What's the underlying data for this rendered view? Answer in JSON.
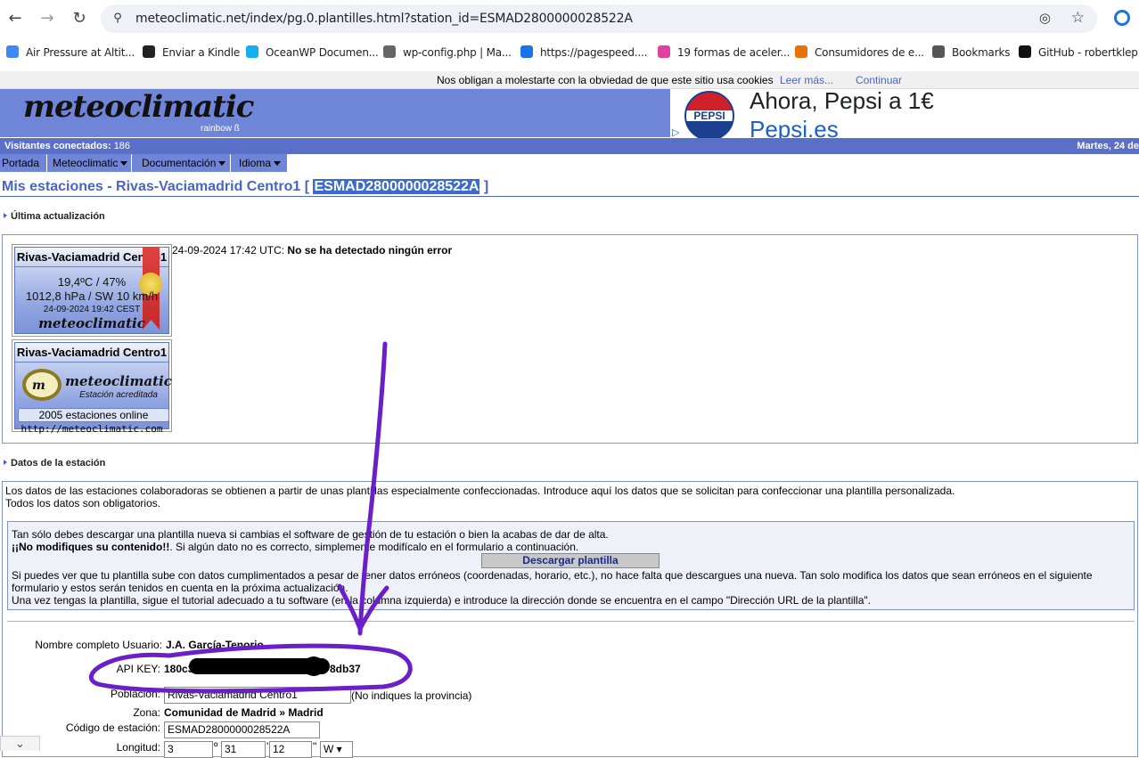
{
  "browser": {
    "url": "meteoclimatic.net/index/pg.0.plantilles.html?station_id=ESMAD2800000028522A",
    "nav_back_glyph": "←",
    "nav_forward_glyph": "→",
    "nav_reload_glyph": "↻",
    "site_info_glyph": "⚲",
    "eye_glyph": "◎",
    "star_glyph": "☆",
    "bookmarks": [
      {
        "label": "Air Pressure at Altit...",
        "color": "#4285f4"
      },
      {
        "label": "Enviar a Kindle",
        "color": "#222222"
      },
      {
        "label": "OceanWP Documen...",
        "color": "#13aff0"
      },
      {
        "label": "wp-config.php | Ma...",
        "color": "#666666"
      },
      {
        "label": "https://pagespeed....",
        "color": "#1a73e8"
      },
      {
        "label": "19 formas de aceler...",
        "color": "#e040a0"
      },
      {
        "label": "Consumidores de e...",
        "color": "#e8710a"
      },
      {
        "label": "Bookmarks",
        "color": "#555555"
      },
      {
        "label": "GitHub - robertklep...",
        "color": "#111111"
      }
    ]
  },
  "cookie_bar": {
    "text": "Nos obligan a molestarte con la obviedad de que este sitio usa cookies",
    "more": "Leer más...",
    "continue": "Continuar"
  },
  "header": {
    "logo": "meteoclimatic",
    "logo_sub": "rainbow ß",
    "ad_brand": "PEPSI",
    "ad_title": "Ahora, Pepsi a 1€",
    "ad_sub": "Pepsi.es",
    "visitors_label": "Visitantes conectados:",
    "visitors_count": "186",
    "date": "Martes, 24 de"
  },
  "menu": [
    "Portada",
    "Meteoclimatic",
    "Documentación",
    "Idioma"
  ],
  "page": {
    "title_prefix": "Mis estaciones - Rivas-Vaciamadrid Centro1 [ ",
    "station_id": "ESMAD2800000028522A",
    "title_suffix": " ]",
    "section_update": "Última actualización",
    "update_time": "24-09-2024 17:42 UTC: ",
    "update_status": "No se ha detectado ningún error",
    "section_station": "Datos de la estación"
  },
  "widget1": {
    "name": "Rivas-Vaciamadrid Centro1",
    "temp_hum": "19,4ºC / 47%",
    "pressure_wind": "1012,8 hPa / SW 10 km/h",
    "datetime": "24-09-2024 19:42 CEST",
    "logo": "meteoclimatic"
  },
  "widget2": {
    "name": "Rivas-Vaciamadrid Centro1",
    "logo": "meteoclimatic",
    "accredited": "Estación acreditada",
    "online": "2005 estaciones online",
    "url": "http://meteoclimatic.com"
  },
  "intro": {
    "line1": "Los datos de las estaciones colaboradoras se obtienen a partir de unas plantillas especialmente confeccionadas. Introduce aquí los datos que se solicitan para confeccionar una plantilla personalizada.",
    "line2": "Todos los datos son obligatorios."
  },
  "info": {
    "line1": "Tan sólo debes descargar una plantilla nueva si cambias el software de gestión de tu estación o bien la acabas de dar de alta.",
    "line2_bold": "¡¡No modifiques su contenido!!",
    "line2_rest": ". Si algún dato no es correcto, simplemente modifícalo en el formulario a continuación.",
    "download_button": "Descargar plantilla",
    "line3": "Si puedes ver que tu plantilla sube con datos cumplimentados a pesar de tener datos erróneos (coordenadas, horario, etc.), no hace falta que descargues una nueva. Tan solo modifica los datos que sean erróneos en el siguiente",
    "line4": "formulario y estos serán tenidos en cuenta en la próxima actualización.",
    "line5": "Una vez tengas la plantilla, sigue el tutorial adecuado a tu software (en la columna izquierda) e introduce la dirección donde se encuentra en el campo \"Dirección URL de la plantilla\"."
  },
  "form": {
    "user_label": "Nombre completo Usuario:",
    "user_value": "J.A. García-Tenorio",
    "api_label": "API KEY:",
    "api_start": "180c3",
    "api_end": "8db37",
    "population_label": "Población:",
    "population_value": "Rivas-Vaciamadrid Centro1",
    "population_hint": "(No indiques la provincia)",
    "zone_label": "Zona:",
    "zone_value": "Comunidad de Madrid » Madrid",
    "code_label": "Código de estación:",
    "code_value": "ESMAD2800000028522A",
    "longitude_label": "Longitud:",
    "lon_deg": "3",
    "lon_deg_mark": "º",
    "lon_min": "31",
    "lon_min_mark": "'",
    "lon_sec": "12",
    "lon_sec_mark": "\"",
    "lon_dir": "W"
  },
  "annotation": {
    "color": "#6a1fc8"
  },
  "close_tab_glyph": "⌄"
}
